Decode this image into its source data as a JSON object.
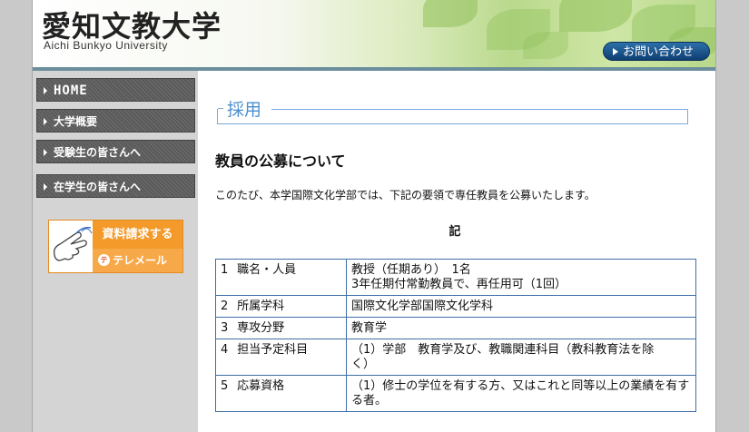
{
  "header": {
    "logo_jp": "愛知文教大学",
    "logo_en": "Aichi Bunkyo University",
    "contact_label": "お問い合わせ"
  },
  "sidebar": {
    "items": [
      {
        "label": "HOME"
      },
      {
        "label": "大学概要"
      },
      {
        "label": "受験生の皆さんへ"
      },
      {
        "label": "在学生の皆さんへ"
      }
    ],
    "banner": {
      "line1": "資料請求する",
      "tel_icon": "テ",
      "line2": "テレメール"
    }
  },
  "main": {
    "section_title": "採用",
    "heading": "教員の公募について",
    "intro": "このたび、本学国際文化学部では、下記の要領で専任教員を公募いたします。",
    "ki": "記",
    "rows": [
      {
        "num": "1",
        "label": "職名・人員",
        "lines": [
          "教授（任期あり）　1名",
          "3年任期付常勤教員で、再任用可（1回）"
        ]
      },
      {
        "num": "2",
        "label": "所属学科",
        "lines": [
          "国際文化学部国際文化学科"
        ]
      },
      {
        "num": "3",
        "label": "専攻分野",
        "lines": [
          "教育学"
        ]
      },
      {
        "num": "4",
        "label": "担当予定科目",
        "lines": [
          "（1）学部　教育学及び、教職関連科目（教科教育法を除",
          "く）"
        ]
      },
      {
        "num": "5",
        "label": "応募資格",
        "lines": [
          "（1）修士の学位を有する方、又はこれと同等以上の業績を有す",
          "る者。"
        ]
      }
    ]
  },
  "colors": {
    "accent_blue": "#4b8fd1",
    "table_border": "#3e6fa6",
    "banner_orange": "#f39a2a",
    "nav_gray": "#5a5a5a"
  }
}
